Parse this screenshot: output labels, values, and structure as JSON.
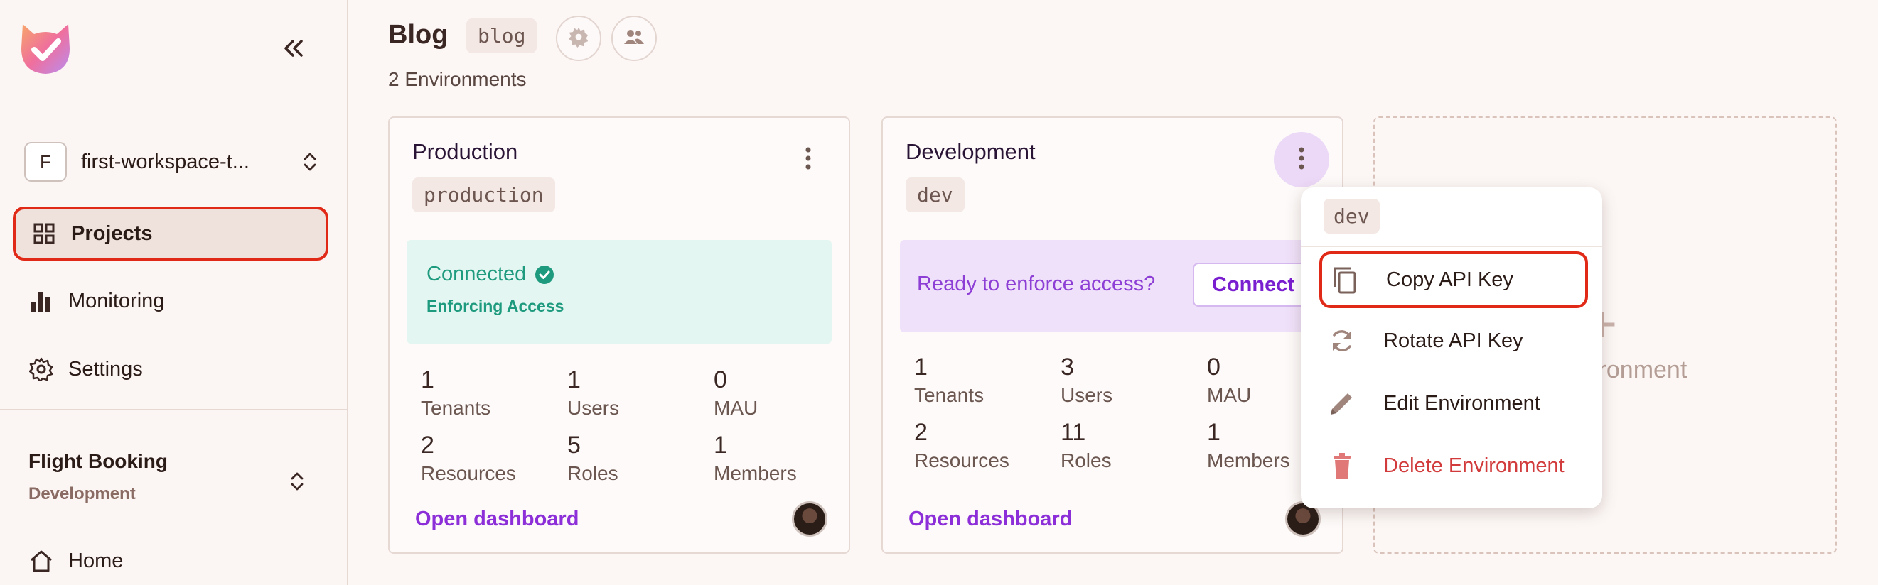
{
  "sidebar": {
    "workspace": {
      "initial": "F",
      "name": "first-workspace-t..."
    },
    "nav": [
      {
        "label": "Projects",
        "icon": "grid-icon"
      },
      {
        "label": "Monitoring",
        "icon": "bar-chart-icon"
      },
      {
        "label": "Settings",
        "icon": "gear-icon"
      }
    ],
    "project": {
      "name": "Flight Booking",
      "environment": "Development"
    },
    "home_label": "Home"
  },
  "header": {
    "title": "Blog",
    "key": "blog",
    "env_count": "2 Environments"
  },
  "cards": [
    {
      "name": "Production",
      "key": "production",
      "status": "Connected",
      "status_sub": "Enforcing Access",
      "stats": [
        {
          "value": "1",
          "label": "Tenants"
        },
        {
          "value": "1",
          "label": "Users"
        },
        {
          "value": "0",
          "label": "MAU"
        },
        {
          "value": "2",
          "label": "Resources"
        },
        {
          "value": "5",
          "label": "Roles"
        },
        {
          "value": "1",
          "label": "Members"
        }
      ],
      "link": "Open dashboard"
    },
    {
      "name": "Development",
      "key": "dev",
      "status": "Ready to enforce access?",
      "connect_label": "Connect",
      "stats": [
        {
          "value": "1",
          "label": "Tenants"
        },
        {
          "value": "3",
          "label": "Users"
        },
        {
          "value": "0",
          "label": "MAU"
        },
        {
          "value": "2",
          "label": "Resources"
        },
        {
          "value": "11",
          "label": "Roles"
        },
        {
          "value": "1",
          "label": "Members"
        }
      ],
      "link": "Open dashboard"
    }
  ],
  "new_env": {
    "plus": "+",
    "label_partial": "vironment"
  },
  "menu": {
    "key": "dev",
    "items": [
      {
        "label": "Copy API Key",
        "icon": "copy-icon"
      },
      {
        "label": "Rotate API Key",
        "icon": "rotate-icon"
      },
      {
        "label": "Edit Environment",
        "icon": "pencil-icon"
      },
      {
        "label": "Delete Environment",
        "icon": "trash-icon"
      }
    ]
  },
  "colors": {
    "accent": "#8d2fd8",
    "connected": "#1e9a7e",
    "danger": "#d23b3b",
    "highlight": "#e02a17"
  }
}
